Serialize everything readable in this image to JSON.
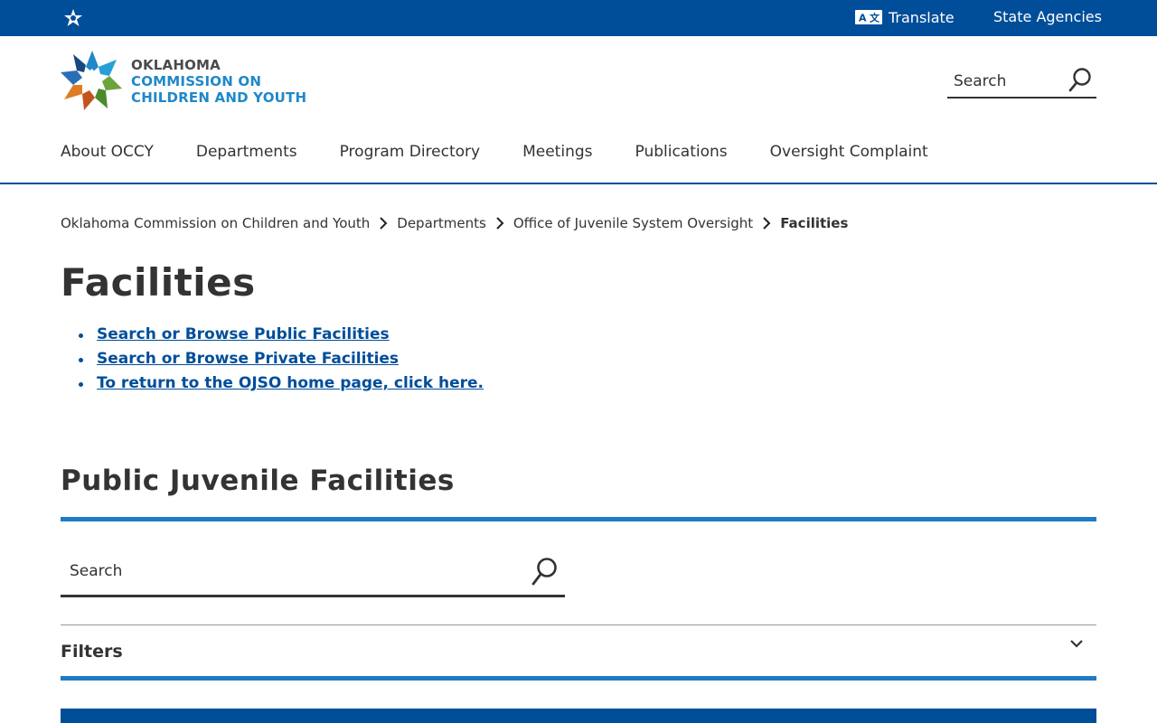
{
  "topbar": {
    "translate_label": "Translate",
    "agencies_label": "State Agencies"
  },
  "logo": {
    "line1": "OKLAHOMA",
    "line2": "COMMISSION ON",
    "line3": "CHILDREN AND YOUTH"
  },
  "header_search": {
    "placeholder": "Search"
  },
  "nav": {
    "items": [
      {
        "label": "About OCCY"
      },
      {
        "label": "Departments"
      },
      {
        "label": "Program Directory"
      },
      {
        "label": "Meetings"
      },
      {
        "label": "Publications"
      },
      {
        "label": "Oversight Complaint"
      }
    ]
  },
  "breadcrumb": {
    "items": [
      {
        "label": "Oklahoma Commission on Children and Youth"
      },
      {
        "label": "Departments"
      },
      {
        "label": "Office of Juvenile System Oversight"
      }
    ],
    "current": "Facilities"
  },
  "page": {
    "title": "Facilities",
    "links": [
      {
        "label": "Search or Browse Public Facilities"
      },
      {
        "label": "Search or Browse Private Facilities"
      },
      {
        "label": "To return to the OJSO home page, click here."
      }
    ]
  },
  "section": {
    "title": "Public Juvenile Facilities",
    "search_placeholder": "Search",
    "filters_label": "Filters"
  },
  "colors": {
    "brand_blue": "#004e9a",
    "accent_blue": "#1f7bc5",
    "text": "#333333"
  }
}
